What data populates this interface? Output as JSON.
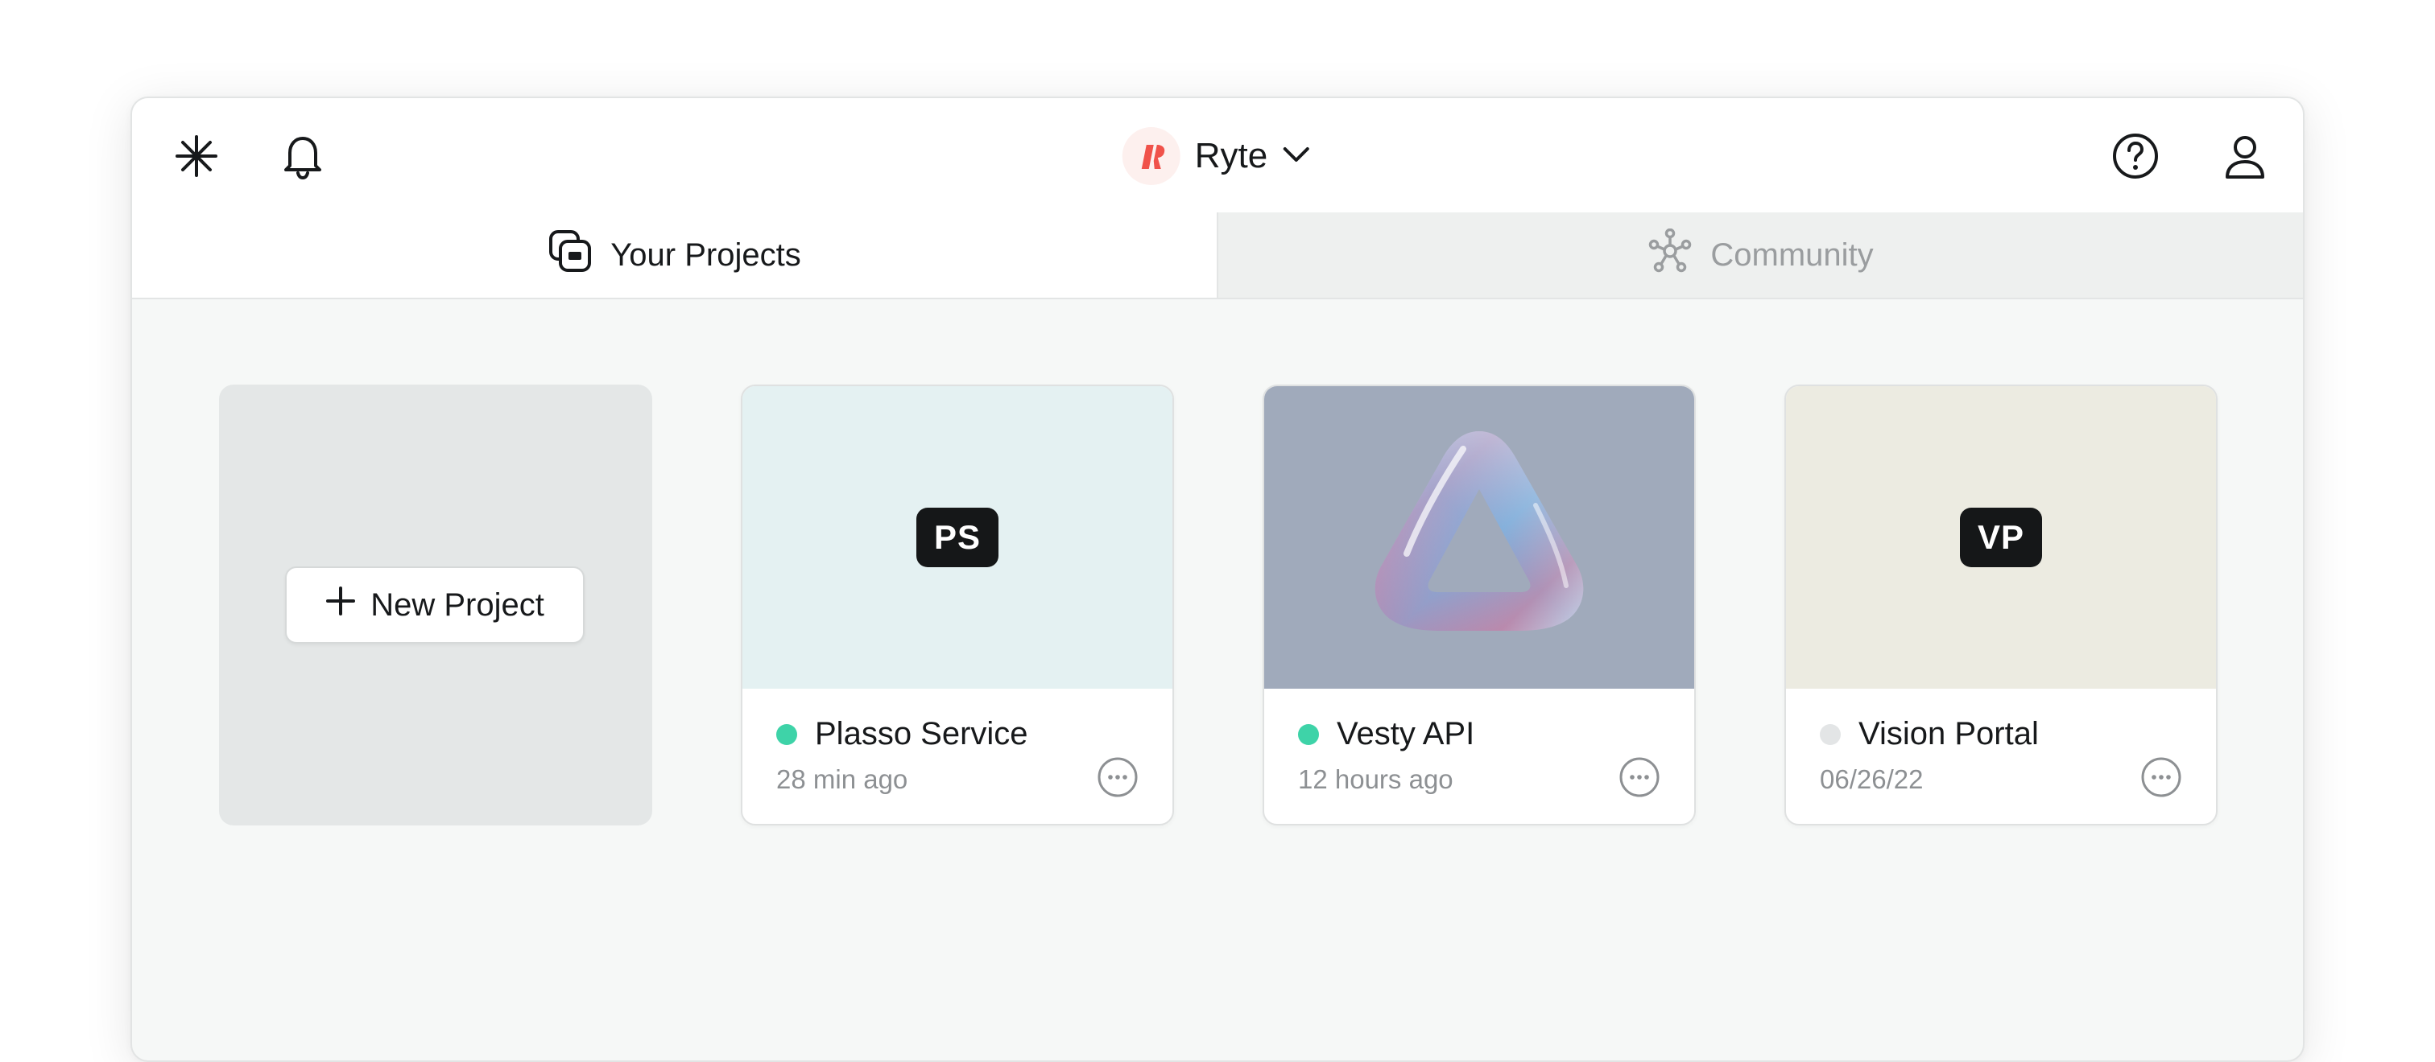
{
  "header": {
    "workspace_name": "Ryte",
    "brand_color": "#f0524a",
    "icons": [
      "sparkle-icon",
      "bell-icon",
      "chevron-down-icon",
      "help-icon",
      "user-icon"
    ]
  },
  "tabs": [
    {
      "label": "Your Projects",
      "icon": "projects-icon",
      "active": true
    },
    {
      "label": "Community",
      "icon": "network-icon",
      "active": false
    }
  ],
  "new_project": {
    "label": "New Project",
    "icon": "plus-icon"
  },
  "projects": [
    {
      "name": "Plasso Service",
      "time": "28 min ago",
      "badge": "PS",
      "status": "active",
      "status_color": "#3ed3a8",
      "thumb_color": "#e4f1f2"
    },
    {
      "name": "Vesty API",
      "time": "12 hours ago",
      "badge": "",
      "status": "active",
      "status_color": "#3ed3a8",
      "thumb_color": "#a0aabb",
      "thumb_image": "glass-triangle-image"
    },
    {
      "name": "Vision Portal",
      "time": "06/26/22",
      "badge": "VP",
      "status": "inactive",
      "status_color": "#e3e5e6",
      "thumb_color": "#ecebe1"
    }
  ]
}
